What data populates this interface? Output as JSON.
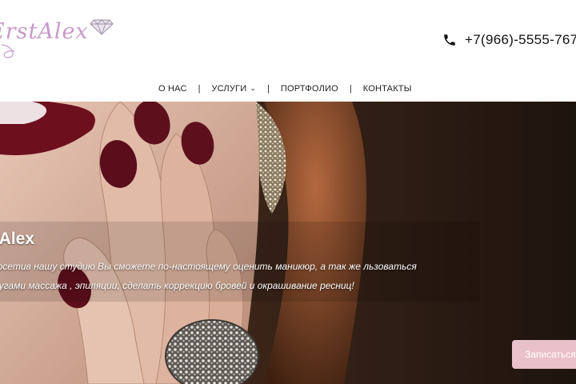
{
  "header": {
    "logo_text": "ErstAlex",
    "phone": {
      "icon": "phone-icon",
      "number": "+7(966)-5555-767"
    }
  },
  "nav": {
    "items": [
      {
        "label": "О НАС"
      },
      {
        "label": "УСЛУГИ",
        "has_dropdown": true
      },
      {
        "label": "ПОРТФОЛИО"
      },
      {
        "label": "КОНТАКТЫ"
      }
    ],
    "separator": "|"
  },
  "hero": {
    "title": "stAlex",
    "text": "е посетив нашу студию Вы сможете по-настоящему оценить маникюр, а так же льзоваться услугами массажа , эпиляции, сделать коррекцию бровей и окрашивание ресниц!",
    "button_label": "Записаться"
  },
  "colors": {
    "logo": "#c79ac9",
    "button": "#eac0ca",
    "nails": "#5e0f1c",
    "hero_background": "#2a1a12"
  }
}
